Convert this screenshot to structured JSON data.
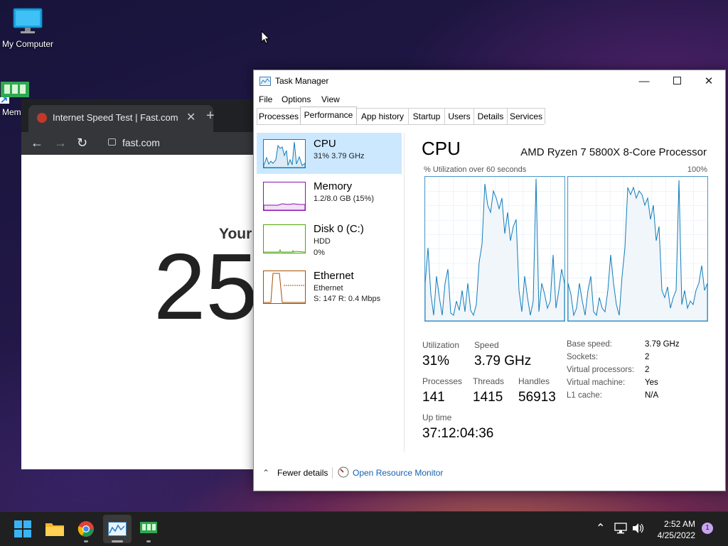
{
  "desktop": {
    "icons": [
      {
        "label": "My Computer"
      },
      {
        "label": "Mem"
      }
    ]
  },
  "browser": {
    "tab_title": "Internet Speed Test | Fast.com",
    "tab_close": "✕",
    "new_tab": "+",
    "url": "fast.com",
    "content_heading": "Your",
    "speed_value": "25"
  },
  "taskmgr": {
    "title": "Task Manager",
    "menu": [
      "File",
      "Options",
      "View"
    ],
    "tabs": [
      "Processes",
      "Performance",
      "App history",
      "Startup",
      "Users",
      "Details",
      "Services"
    ],
    "active_tab": "Performance",
    "sidebar": [
      {
        "name": "CPU",
        "sub1": "31% 3.79 GHz",
        "sub2": "",
        "color": "#117dbb"
      },
      {
        "name": "Memory",
        "sub1": "1.2/8.0 GB (15%)",
        "sub2": "",
        "color": "#8b12ae"
      },
      {
        "name": "Disk 0 (C:)",
        "sub1": "HDD",
        "sub2": "0%",
        "color": "#4da60c"
      },
      {
        "name": "Ethernet",
        "sub1": "Ethernet",
        "sub2": "S: 147 R: 0.4 Mbps",
        "color": "#a74f01"
      }
    ],
    "cpu": {
      "heading": "CPU",
      "model": "AMD Ryzen 7 5800X 8-Core Processor",
      "graph_label": "% Utilization over 60 seconds",
      "graph_max": "100%",
      "stats": {
        "utilization_label": "Utilization",
        "utilization": "31%",
        "speed_label": "Speed",
        "speed": "3.79 GHz",
        "processes_label": "Processes",
        "processes": "141",
        "threads_label": "Threads",
        "threads": "1415",
        "handles_label": "Handles",
        "handles": "56913",
        "uptime_label": "Up time",
        "uptime": "37:12:04:36"
      },
      "specs": [
        {
          "label": "Base speed:",
          "value": "3.79 GHz"
        },
        {
          "label": "Sockets:",
          "value": "2"
        },
        {
          "label": "Virtual processors:",
          "value": "2"
        },
        {
          "label": "Virtual machine:",
          "value": "Yes"
        },
        {
          "label": "L1 cache:",
          "value": "N/A"
        }
      ]
    },
    "footer": {
      "fewer_details": "Fewer details",
      "resource_monitor": "Open Resource Monitor"
    }
  },
  "taskbar": {
    "apps": [
      "start-icon",
      "file-explorer-icon",
      "chrome-icon",
      "task-manager-icon",
      "memory-app-icon"
    ],
    "time": "2:52 AM",
    "date": "4/25/2022",
    "notification_count": "1"
  }
}
